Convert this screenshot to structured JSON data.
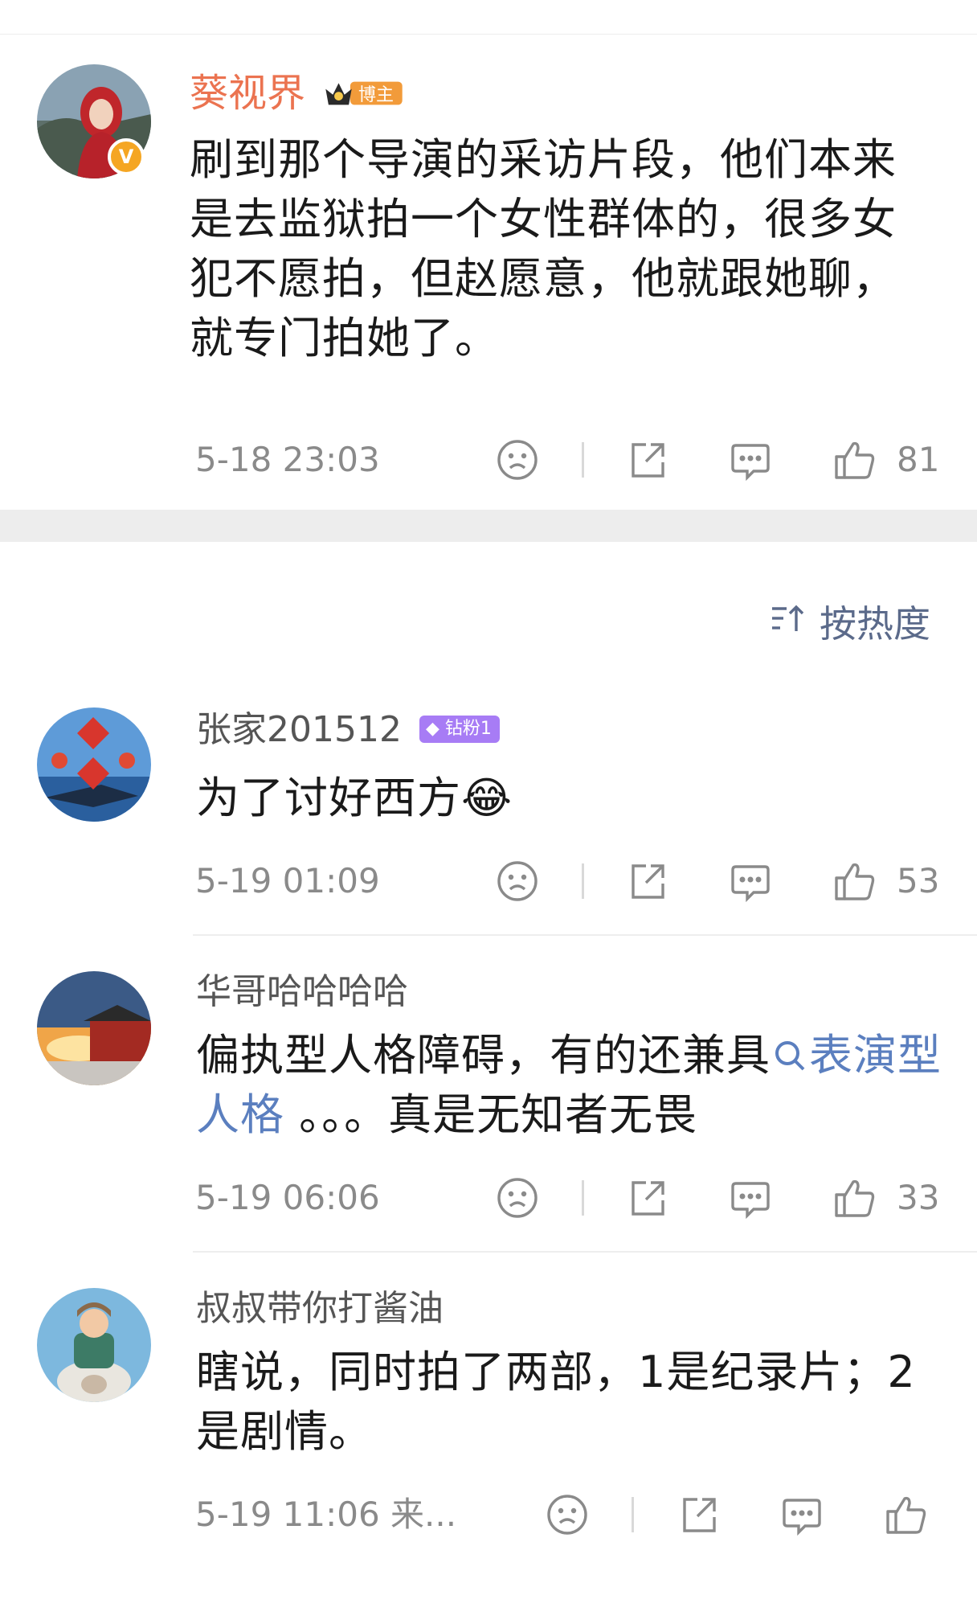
{
  "main_post": {
    "author": "葵视界",
    "badge": "博主",
    "text": "刷到那个导演的采访片段，他们本来是去监狱拍一个女性群体的，很多女犯不愿拍，但赵愿意，他就跟她聊，就专门拍她了。",
    "time": "5-18 23:03",
    "likes": "81"
  },
  "sort": {
    "label": "按热度"
  },
  "comments": [
    {
      "author": "张家201512",
      "badge": "钻粉1",
      "text": "为了讨好西方",
      "emoji": "😂",
      "time": "5-19 01:09",
      "likes": "53"
    },
    {
      "author": "华哥哈哈哈哈",
      "text_before": "偏执型人格障碍，有的还兼具",
      "link": "表演型人格",
      "text_after": " 。。。真是无知者无畏",
      "time": "5-19 06:06",
      "likes": "33"
    },
    {
      "author": "叔叔带你打酱油",
      "text": "瞎说，同时拍了两部，1是纪录片；2是剧情。",
      "time": "5-19 11:06 来..."
    }
  ],
  "icons": {
    "dislike": "sad-face-icon",
    "share": "share-icon",
    "comment": "comment-bubble-icon",
    "like": "thumbs-up-icon",
    "search": "search-icon",
    "sort": "sort-icon"
  },
  "colors": {
    "author_highlight": "#eb7350",
    "link": "#5b7fbf",
    "fan_badge": "#a77cf5",
    "vip_badge": "#f5a623",
    "meta_text": "#8a8a8a"
  }
}
